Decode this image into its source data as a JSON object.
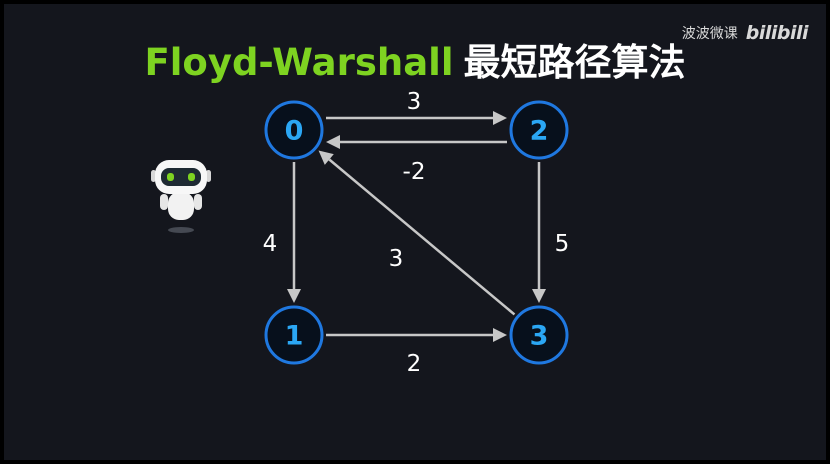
{
  "title": {
    "english": "Floyd-Warshall",
    "chinese": "最短路径算法"
  },
  "brand": {
    "name": "波波微课",
    "logo": "bilibili"
  },
  "graph": {
    "nodes": [
      {
        "id": "0",
        "label": "0"
      },
      {
        "id": "2",
        "label": "2"
      },
      {
        "id": "1",
        "label": "1"
      },
      {
        "id": "3",
        "label": "3"
      }
    ],
    "edges": [
      {
        "from": "0",
        "to": "2",
        "weight": "3"
      },
      {
        "from": "2",
        "to": "0",
        "weight": "-2"
      },
      {
        "from": "0",
        "to": "1",
        "weight": "4"
      },
      {
        "from": "2",
        "to": "3",
        "weight": "5"
      },
      {
        "from": "3",
        "to": "0",
        "weight": "3"
      },
      {
        "from": "1",
        "to": "3",
        "weight": "2"
      }
    ]
  },
  "colors": {
    "title_english": "#7ed321",
    "title_chinese": "#ffffff",
    "node_stroke": "#1f78e0",
    "node_label": "#2ba7f4",
    "edge": "#c7c7c7",
    "background": "#14161d"
  },
  "icons": {
    "mascot": "robot-icon"
  }
}
